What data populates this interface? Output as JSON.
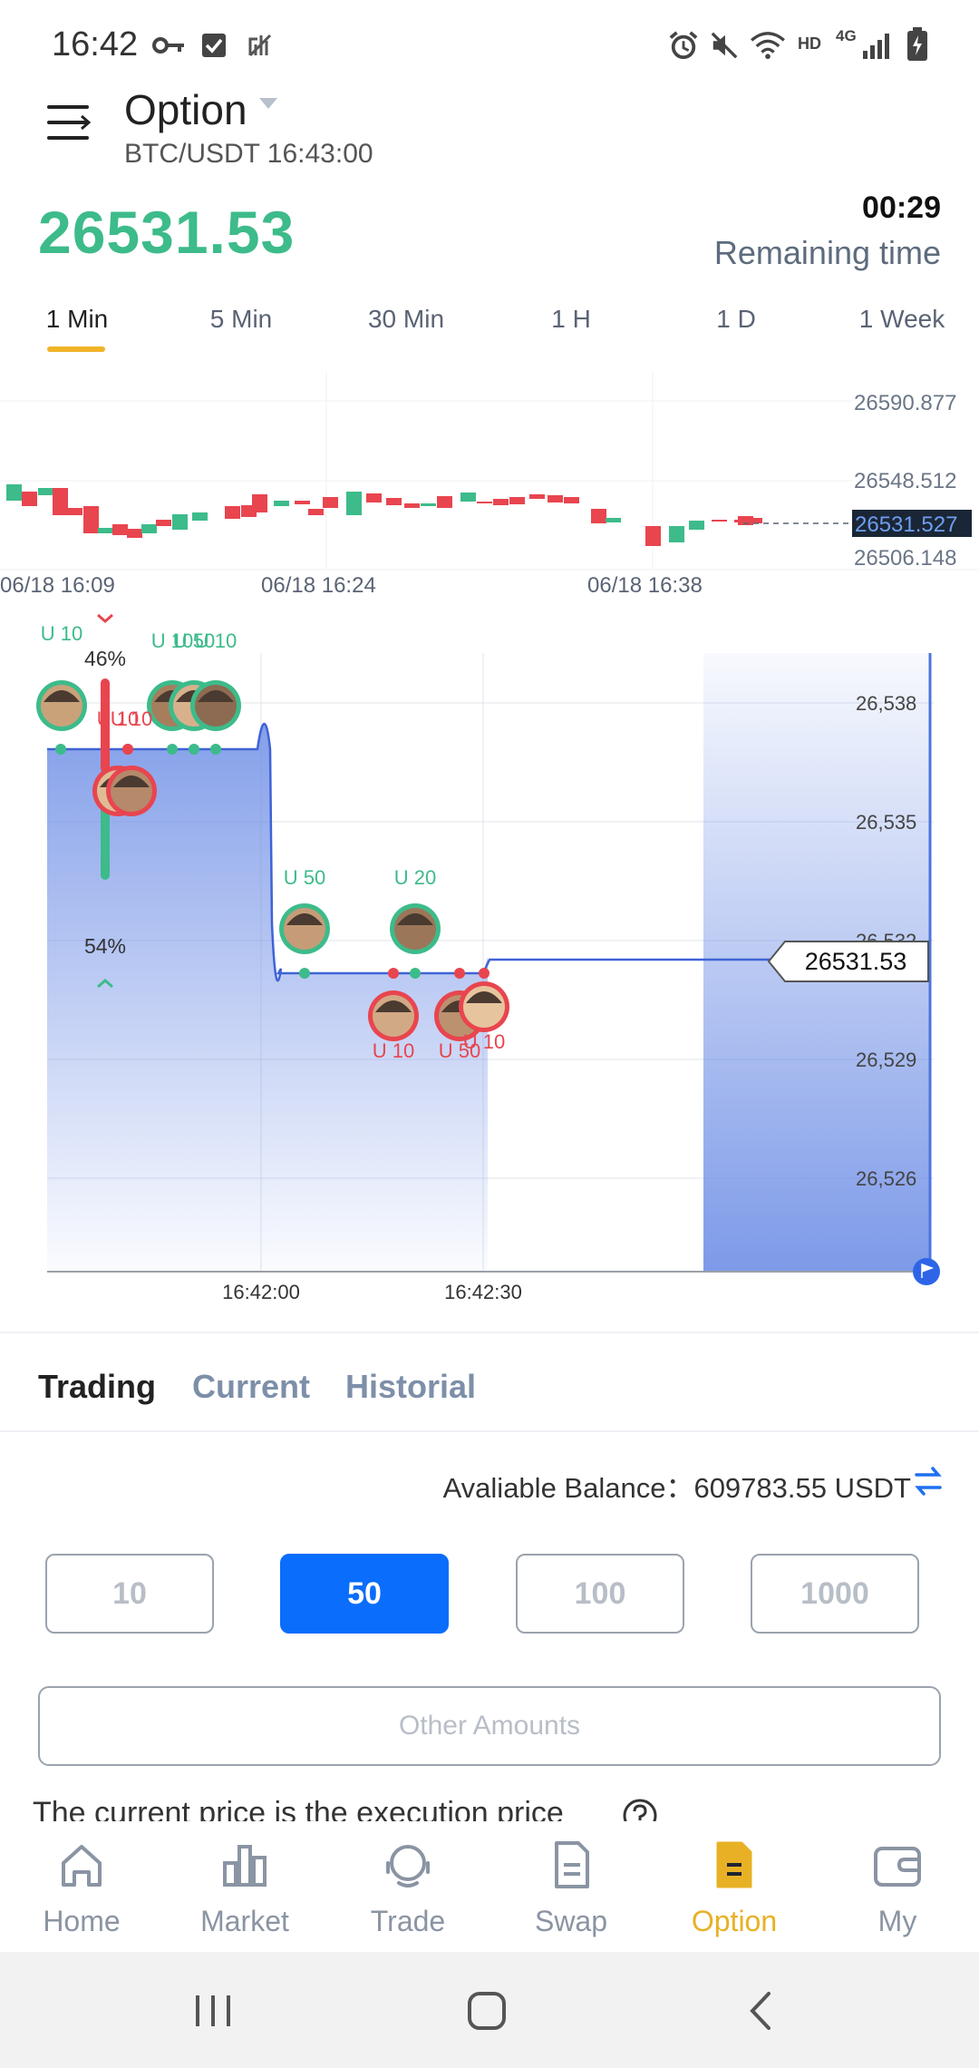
{
  "status_bar": {
    "time": "16:42",
    "icons": [
      "key-icon",
      "checkbox-icon",
      "nfc-icon",
      "alarm-icon",
      "mute-icon",
      "wifi-icon",
      "hd-icon",
      "4g-icon",
      "signal-icon",
      "battery-icon"
    ],
    "hd_label": "HD",
    "network_label": "4G"
  },
  "header": {
    "title": "Option",
    "subtitle": "BTC/USDT 16:43:00",
    "price": "26531.53",
    "countdown": "00:29",
    "remaining_label": "Remaining time"
  },
  "intervals": [
    "1 Min",
    "5 Min",
    "30 Min",
    "1 H",
    "1 D",
    "1 Week"
  ],
  "active_interval": "1 Min",
  "kline": {
    "price_labels": [
      "26590.877",
      "26548.512",
      "26531.527",
      "26506.148"
    ],
    "current_price": "26531.527",
    "time_labels": [
      "06/18 16:09",
      "06/18 16:24",
      "06/18 16:38"
    ]
  },
  "option_chart": {
    "y_labels": [
      "26,538",
      "26,535",
      "26,532",
      "26,529",
      "26,526"
    ],
    "x_labels": [
      "16:42:00",
      "16:42:30"
    ],
    "sentiment_down": "46%",
    "sentiment_up": "54%",
    "current_price": "26531.53",
    "bets": [
      {
        "label": "U 10",
        "dir": "up"
      },
      {
        "label": "U 10",
        "dir": "up"
      },
      {
        "label": "U 50",
        "dir": "up"
      },
      {
        "label": "U 10",
        "dir": "up"
      },
      {
        "label": "U 10",
        "dir": "down"
      },
      {
        "label": "U 10",
        "dir": "down"
      },
      {
        "label": "U 50",
        "dir": "up"
      },
      {
        "label": "U 20",
        "dir": "up"
      },
      {
        "label": "U 10",
        "dir": "down"
      },
      {
        "label": "U 50",
        "dir": "down"
      },
      {
        "label": "U 10",
        "dir": "down"
      }
    ],
    "colors": {
      "up": "#3dbb8a",
      "down": "#e8454f",
      "area": "#6f8fe6"
    }
  },
  "trade_tabs": [
    "Trading",
    "Current",
    "Historial"
  ],
  "balance": {
    "label": "Avaliable Balance：",
    "value": "609783.55 USDT"
  },
  "amounts": [
    "10",
    "50",
    "100",
    "1000"
  ],
  "selected_amount": "50",
  "other_amounts": "Other Amounts",
  "exec_note": "The current price is the execution price",
  "nav": [
    {
      "label": "Home",
      "icon": "home-icon"
    },
    {
      "label": "Market",
      "icon": "market-icon"
    },
    {
      "label": "Trade",
      "icon": "trade-icon"
    },
    {
      "label": "Swap",
      "icon": "swap-icon"
    },
    {
      "label": "Option",
      "icon": "option-icon"
    },
    {
      "label": "My",
      "icon": "wallet-icon"
    }
  ],
  "active_nav": "Option",
  "accent": "#0a6dfb",
  "nav_accent": "#e8b125"
}
